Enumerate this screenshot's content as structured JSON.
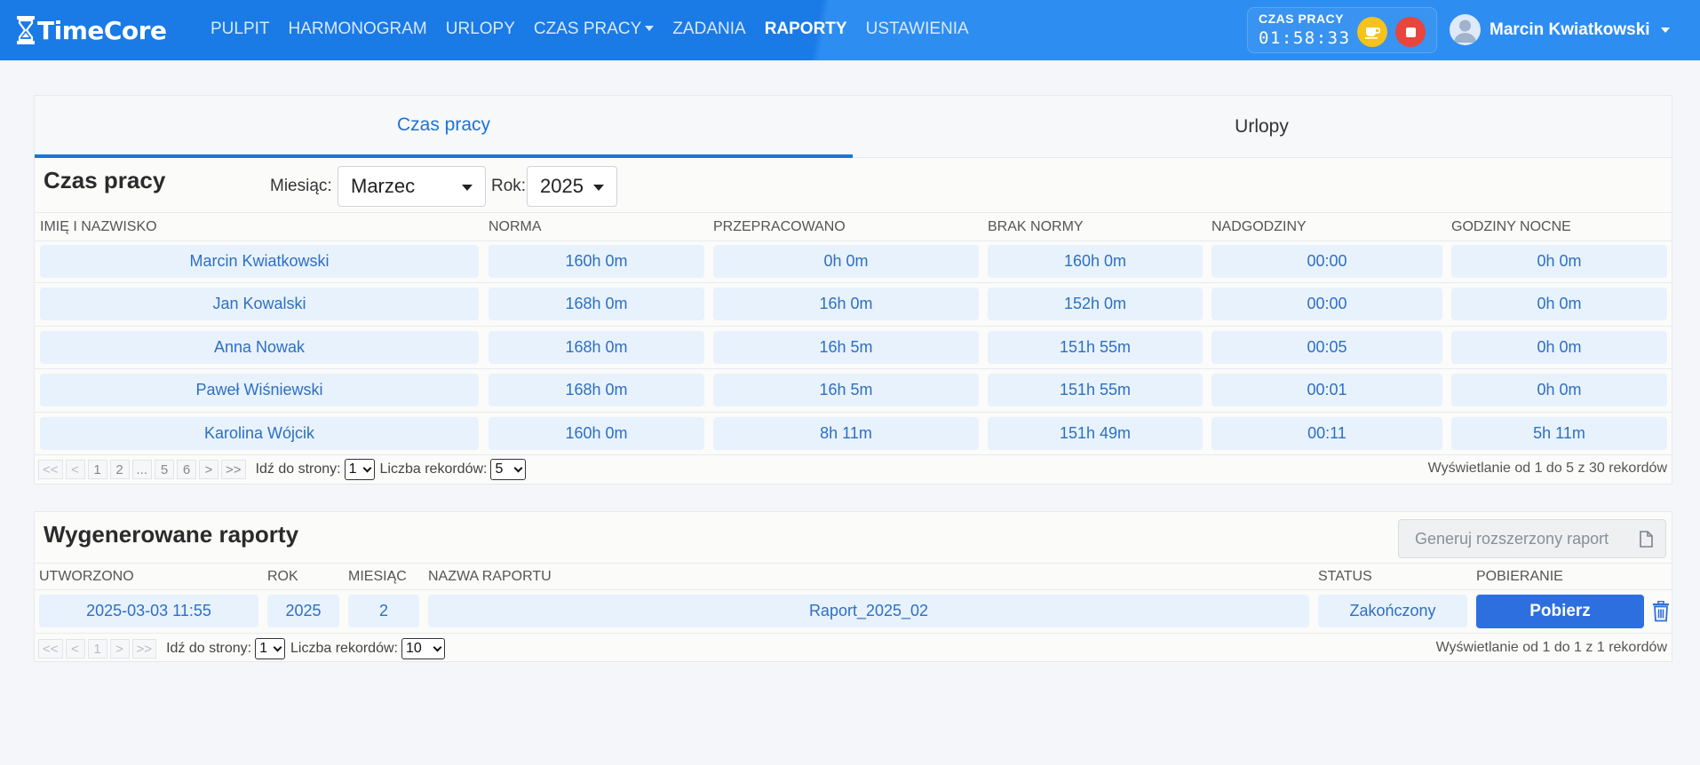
{
  "app": {
    "name": "TimeCore"
  },
  "nav": {
    "items": [
      {
        "label": "PULPIT",
        "active": false
      },
      {
        "label": "HARMONOGRAM",
        "active": false
      },
      {
        "label": "URLOPY",
        "active": false
      },
      {
        "label": "CZAS PRACY",
        "active": false,
        "dropdown": true
      },
      {
        "label": "ZADANIA",
        "active": false
      },
      {
        "label": "RAPORTY",
        "active": true
      },
      {
        "label": "USTAWIENIA",
        "active": false
      }
    ]
  },
  "timer": {
    "label": "CZAS PRACY",
    "value": "01:58:33",
    "break_icon": "coffee-cup-icon",
    "stop_icon": "stop-icon"
  },
  "user": {
    "name": "Marcin Kwiatkowski",
    "avatar_icon": "user-avatar-icon"
  },
  "tabs": {
    "work": "Czas pracy",
    "leave": "Urlopy",
    "active": "work"
  },
  "work_report": {
    "title": "Czas pracy",
    "month_label": "Miesiąc:",
    "month_value": "Marzec",
    "year_label": "Rok:",
    "year_value": "2025",
    "columns": [
      "IMIĘ I NAZWISKO",
      "NORMA",
      "PRZEPRACOWANO",
      "BRAK NORMY",
      "NADGODZINY",
      "GODZINY NOCNE"
    ],
    "rows": [
      [
        "Marcin Kwiatkowski",
        "160h 0m",
        "0h 0m",
        "160h 0m",
        "00:00",
        "0h 0m"
      ],
      [
        "Jan Kowalski",
        "168h 0m",
        "16h 0m",
        "152h 0m",
        "00:00",
        "0h 0m"
      ],
      [
        "Anna Nowak",
        "168h 0m",
        "16h 5m",
        "151h 55m",
        "00:05",
        "0h 0m"
      ],
      [
        "Paweł Wiśniewski",
        "168h 0m",
        "16h 5m",
        "151h 55m",
        "00:01",
        "0h 0m"
      ],
      [
        "Karolina Wójcik",
        "160h 0m",
        "8h 11m",
        "151h 49m",
        "00:11",
        "5h 11m"
      ]
    ],
    "pager": {
      "first": "<<",
      "prev": "<",
      "pages": [
        "1",
        "2",
        "...",
        "5",
        "6"
      ],
      "next": ">",
      "last": ">>",
      "goto_label": "Idź do strony:",
      "goto_value": "1",
      "records_label": "Liczba rekordów:",
      "records_value": "5"
    },
    "records_info": "Wyświetlanie od 1 do 5 z 30 rekordów"
  },
  "generated_reports": {
    "title": "Wygenerowane raporty",
    "generate_button": "Generuj rozszerzony raport",
    "generate_icon": "document-icon",
    "columns": [
      "UTWORZONO",
      "ROK",
      "MIESIĄC",
      "NAZWA RAPORTU",
      "STATUS",
      "POBIERANIE"
    ],
    "rows": [
      {
        "created": "2025-03-03 11:55",
        "year": "2025",
        "month": "2",
        "name": "Raport_2025_02",
        "status": "Zakończony",
        "download": "Pobierz"
      }
    ],
    "pager": {
      "first": "<<",
      "prev": "<",
      "pages": [
        "1"
      ],
      "next": ">",
      "last": ">>",
      "goto_label": "Idź do strony:",
      "goto_value": "1",
      "records_label": "Liczba rekordów:",
      "records_value": "10"
    },
    "records_info": "Wyświetlanie od 1 do 1 z 1 rekordów"
  },
  "colors": {
    "header": "#1a7ae6",
    "accent": "#1a74d9",
    "cell_bg": "#e8f2fd",
    "cell_text": "#2d6fc4",
    "download_button": "#2d6fde",
    "break_button": "#f6c21b",
    "stop_button": "#e8453c",
    "trash": "#2d6fde"
  }
}
